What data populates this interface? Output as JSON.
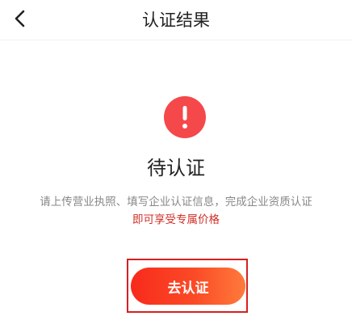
{
  "header": {
    "title": "认证结果",
    "back_icon": "chevron-left-icon"
  },
  "status": {
    "icon": "exclamation-icon",
    "icon_color": "#f5484a",
    "title": "待认证",
    "description": "请上传营业执照、填写企业认证信息，完成企业资质认证",
    "highlight": "即可享受专属价格",
    "highlight_color": "#d0302a"
  },
  "action": {
    "button_label": "去认证",
    "button_gradient": [
      "#f82a1c",
      "#ff7a3b"
    ],
    "frame_color": "#d81f1f"
  }
}
